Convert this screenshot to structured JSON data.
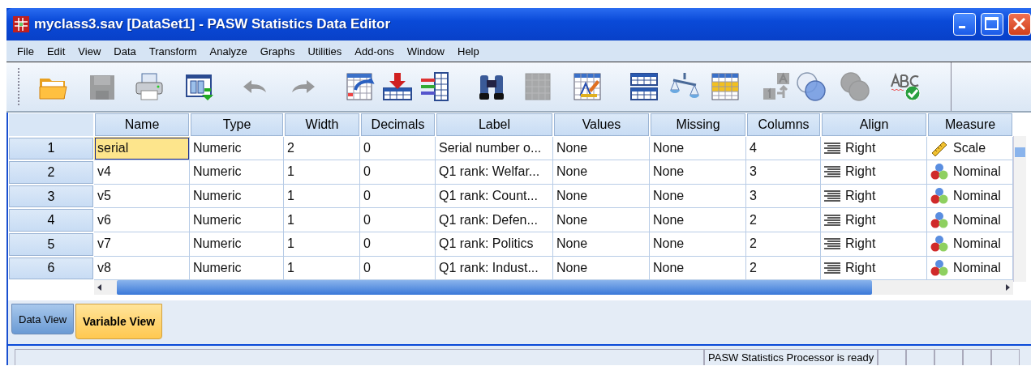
{
  "window": {
    "title": "myclass3.sav [DataSet1] - PASW Statistics Data Editor"
  },
  "menu": [
    "File",
    "Edit",
    "View",
    "Data",
    "Transform",
    "Analyze",
    "Graphs",
    "Utilities",
    "Add-ons",
    "Window",
    "Help"
  ],
  "toolbar": [
    {
      "kind": "open",
      "disabled": false
    },
    {
      "kind": "save",
      "disabled": true
    },
    {
      "kind": "print",
      "disabled": false
    },
    {
      "kind": "recall",
      "disabled": false
    },
    {
      "kind": "undo",
      "disabled": true
    },
    {
      "kind": "redo",
      "disabled": true
    },
    {
      "kind": "goto-case",
      "disabled": false
    },
    {
      "kind": "goto-variable",
      "disabled": false
    },
    {
      "kind": "variables",
      "disabled": false
    },
    {
      "kind": "find",
      "disabled": false
    },
    {
      "kind": "insert-cases",
      "disabled": true
    },
    {
      "kind": "edit-table",
      "disabled": false
    },
    {
      "kind": "split",
      "disabled": false
    },
    {
      "kind": "weight",
      "disabled": false
    },
    {
      "kind": "select",
      "disabled": false
    },
    {
      "kind": "value-labels",
      "disabled": true
    },
    {
      "kind": "sets",
      "disabled": false
    },
    {
      "kind": "sets",
      "disabled": true
    },
    {
      "kind": "spell",
      "disabled": false
    }
  ],
  "table": {
    "columns": [
      "Name",
      "Type",
      "Width",
      "Decimals",
      "Label",
      "Values",
      "Missing",
      "Columns",
      "Align",
      "Measure"
    ],
    "rows": [
      {
        "number": "1",
        "selected": true,
        "cells": [
          "serial",
          "Numeric",
          "2",
          "0",
          "Serial number o...",
          "None",
          "None",
          "4"
        ],
        "align": "Right",
        "measure": {
          "kind": "scale",
          "text": "Scale"
        }
      },
      {
        "number": "2",
        "selected": false,
        "cells": [
          "v4",
          "Numeric",
          "1",
          "0",
          "Q1 rank: Welfar...",
          "None",
          "None",
          "3"
        ],
        "align": "Right",
        "measure": {
          "kind": "nominal",
          "text": "Nominal"
        }
      },
      {
        "number": "3",
        "selected": false,
        "cells": [
          "v5",
          "Numeric",
          "1",
          "0",
          "Q1 rank: Count...",
          "None",
          "None",
          "3"
        ],
        "align": "Right",
        "measure": {
          "kind": "nominal",
          "text": "Nominal"
        }
      },
      {
        "number": "4",
        "selected": false,
        "cells": [
          "v6",
          "Numeric",
          "1",
          "0",
          "Q1 rank: Defen...",
          "None",
          "None",
          "2"
        ],
        "align": "Right",
        "measure": {
          "kind": "nominal",
          "text": "Nominal"
        }
      },
      {
        "number": "5",
        "selected": false,
        "cells": [
          "v7",
          "Numeric",
          "1",
          "0",
          "Q1 rank: Politics",
          "None",
          "None",
          "2"
        ],
        "align": "Right",
        "measure": {
          "kind": "nominal",
          "text": "Nominal"
        }
      },
      {
        "number": "6",
        "selected": false,
        "cells": [
          "v8",
          "Numeric",
          "1",
          "0",
          "Q1 rank: Indust...",
          "None",
          "None",
          "2"
        ],
        "align": "Right",
        "measure": {
          "kind": "nominal",
          "text": "Nominal"
        }
      }
    ]
  },
  "tabs": [
    {
      "label": "Data View",
      "selected": false
    },
    {
      "label": "Variable View",
      "selected": true
    }
  ],
  "status_bar": "PASW Statistics Processor is ready"
}
